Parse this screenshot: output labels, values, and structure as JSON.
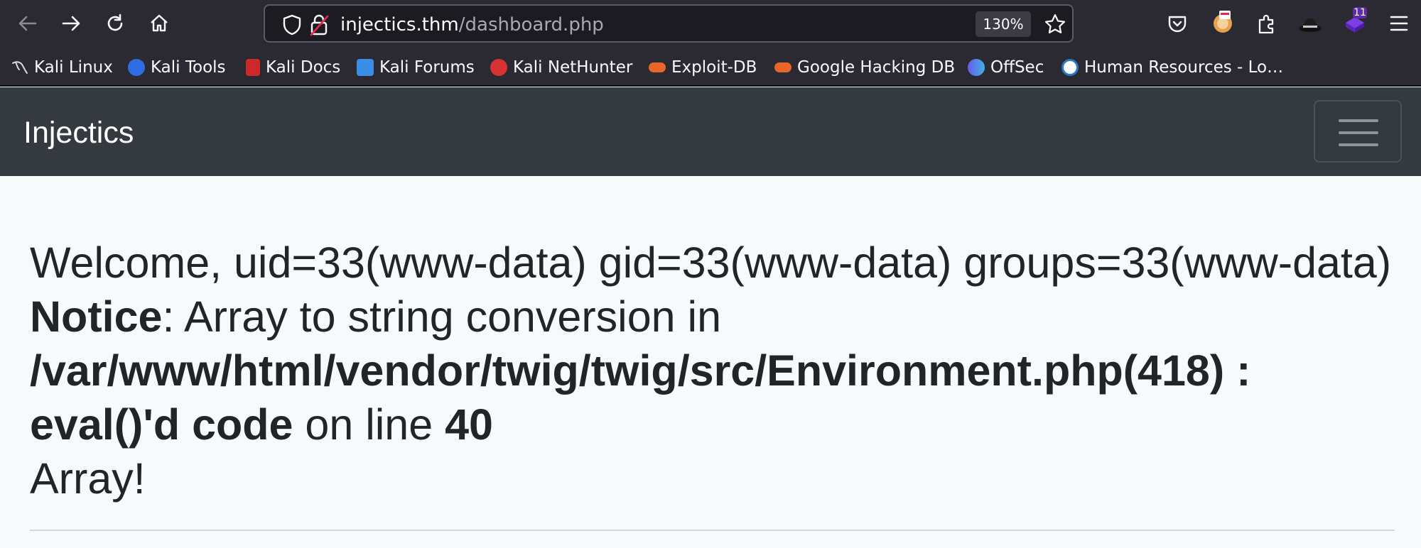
{
  "browser": {
    "url_host": "injectics.thm",
    "url_path": "/dashboard.php",
    "zoom": "130%",
    "extension_badge": "11",
    "icons": [
      "back-icon",
      "forward-icon",
      "reload-icon",
      "home-icon",
      "shield-icon",
      "lock-off-icon",
      "star-icon",
      "pocket-icon",
      "extension-icon",
      "puzzle-icon",
      "hat-icon",
      "menu-icon"
    ]
  },
  "bookmarks": [
    {
      "label": "Kali Linux",
      "color": "#4a4a4a"
    },
    {
      "label": "Kali Tools",
      "color": "#2d6de0"
    },
    {
      "label": "Kali Docs",
      "color": "#cc2a2a"
    },
    {
      "label": "Kali Forums",
      "color": "#3b8ee8"
    },
    {
      "label": "Kali NetHunter",
      "color": "#d83232"
    },
    {
      "label": "Exploit-DB",
      "color": "#e8662a"
    },
    {
      "label": "Google Hacking DB",
      "color": "#e8662a"
    },
    {
      "label": "OffSec",
      "color": "#6b5ce8"
    },
    {
      "label": "Human Resources - Lo…",
      "color": "#2b78c6"
    }
  ],
  "page": {
    "brand": "Injectics",
    "welcome": "Welcome, uid=33(www-data) gid=33(www-data) groups=33(www-data)",
    "notice_label": "Notice",
    "notice_mid": ": Array to string conversion in ",
    "notice_path": "/var/www/html/vendor/twig/twig/src/Environment.php(418) : eval()'d code",
    "notice_on": " on line ",
    "notice_line": "40",
    "trailer": "Array!"
  }
}
